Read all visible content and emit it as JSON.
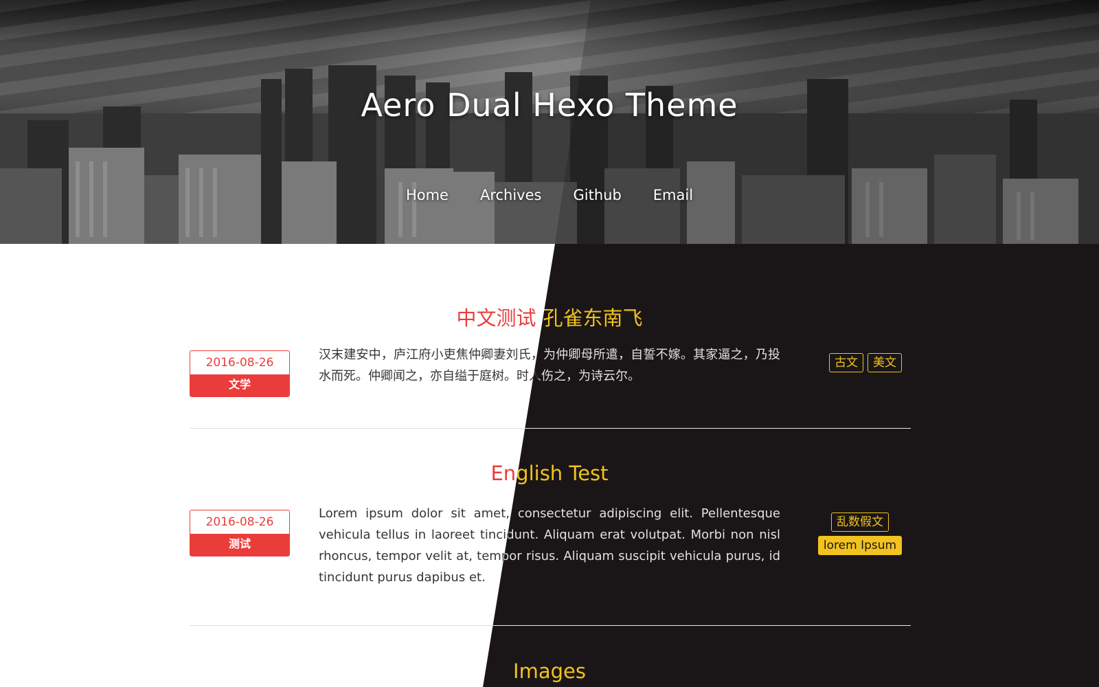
{
  "site": {
    "title": "Aero Dual Hexo Theme",
    "nav": [
      "Home",
      "Archives",
      "Github",
      "Email"
    ]
  },
  "posts": [
    {
      "title_left": "中文测试",
      "title_right": "孔雀东南飞",
      "date": "2016-08-26",
      "category": "文学",
      "excerpt": "汉末建安中，庐江府小吏焦仲卿妻刘氏，为仲卿母所遣，自誓不嫁。其家逼之，乃投水而死。仲卿闻之，亦自缢于庭树。时人伤之，为诗云尔。",
      "tags": [
        "古文",
        "美文"
      ]
    },
    {
      "title_left": "En",
      "title_right": "glish Test",
      "date": "2016-08-26",
      "category": "测试",
      "excerpt": "Lorem ipsum dolor sit amet, consectetur adipiscing elit. Pellentesque vehicula tellus in laoreet tincidunt. Aliquam erat volutpat. Morbi non nisl rhoncus, tempor velit at, tempor risus. Aliquam suscipit vehicula purus, id tincidunt purus dapibus et.",
      "tags": [
        "乱数假文",
        "lorem Ipsum"
      ]
    },
    {
      "title_right": "Images"
    }
  ],
  "colors": {
    "accent_red": "#ea3d3b",
    "accent_yellow": "#f2c21e",
    "dark_bg": "#1a1617",
    "light_bg": "#ffffff"
  }
}
